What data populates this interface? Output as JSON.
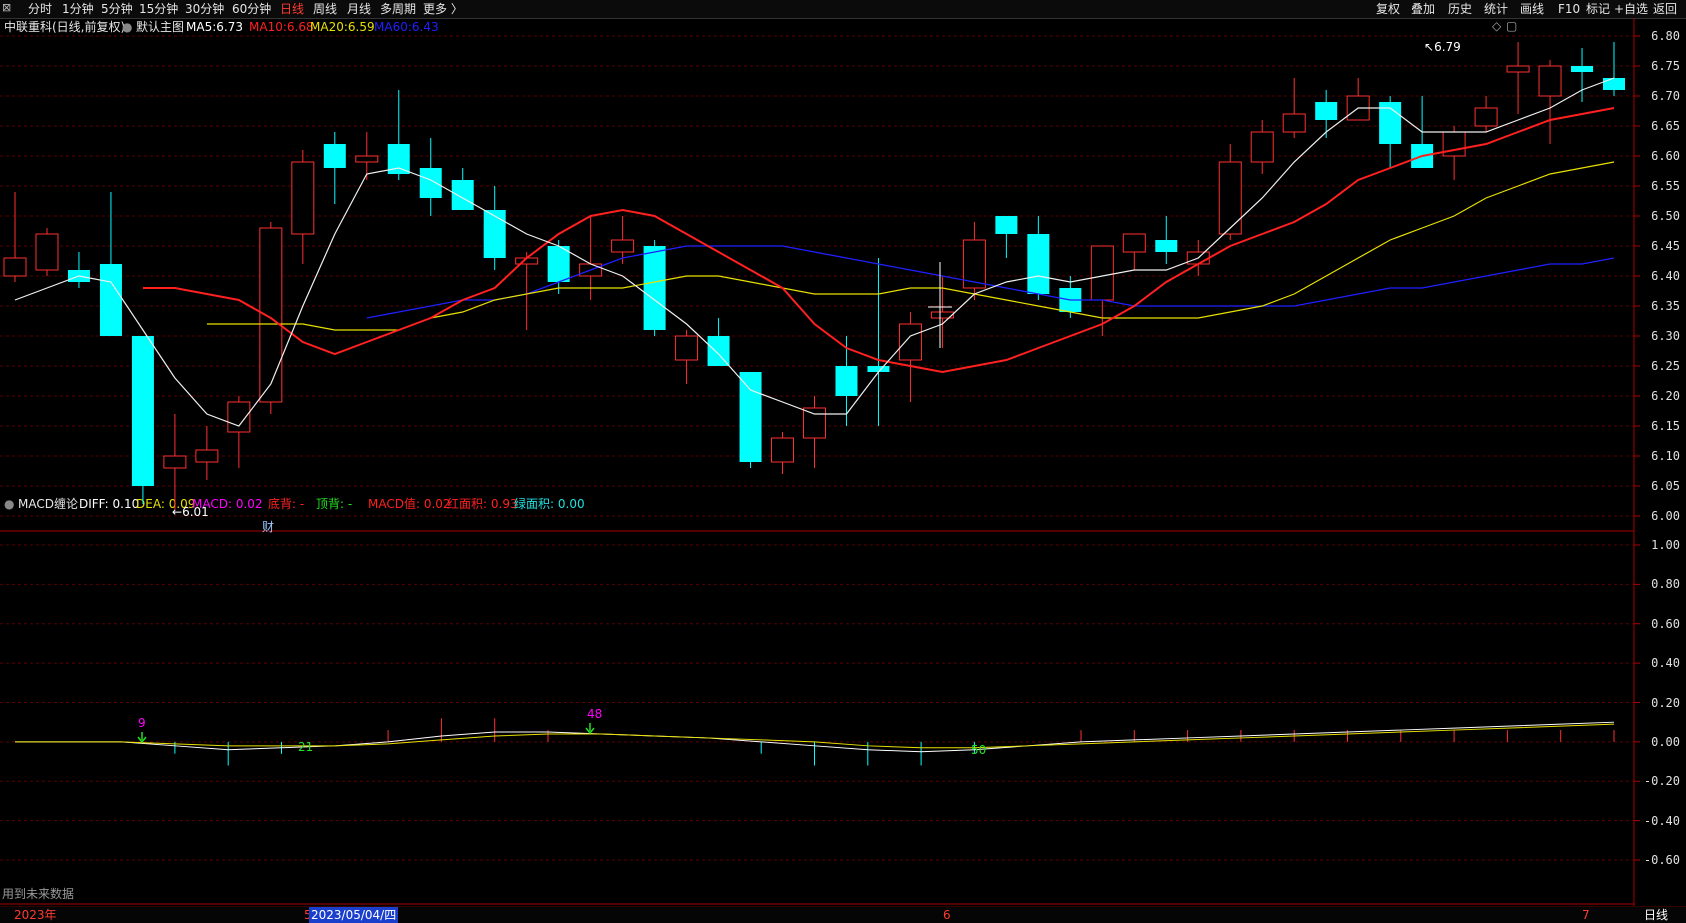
{
  "toolbar": {
    "left": [
      {
        "label": "分时",
        "active": false
      },
      {
        "label": "1分钟",
        "active": false
      },
      {
        "label": "5分钟",
        "active": false
      },
      {
        "label": "15分钟",
        "active": false
      },
      {
        "label": "30分钟",
        "active": false
      },
      {
        "label": "60分钟",
        "active": false
      },
      {
        "label": "日线",
        "active": true
      },
      {
        "label": "周线",
        "active": false
      },
      {
        "label": "月线",
        "active": false
      },
      {
        "label": "多周期",
        "active": false
      },
      {
        "label": "更多 〉",
        "active": false
      }
    ],
    "right": [
      "复权",
      "叠加",
      "历史",
      "统计",
      "画线",
      "F10",
      "标记",
      "+自选",
      "返回"
    ]
  },
  "main_chart": {
    "stock_label": "中联重科(日线,前复权)",
    "template_label": "默认主图",
    "ma5": {
      "label": "MA5:",
      "value": "6.73",
      "color": "#ffffff"
    },
    "ma10": {
      "label": "MA10:",
      "value": "6.68",
      "color": "#ff2020"
    },
    "ma20": {
      "label": "MA20:",
      "value": "6.59",
      "color": "#e8e000"
    },
    "ma60": {
      "label": "MA60:",
      "value": "6.43",
      "color": "#2020ff"
    },
    "max_label": "6.79",
    "min_label": "6.01",
    "fin_marker": "财",
    "y_axis": [
      "6.80",
      "6.75",
      "6.70",
      "6.65",
      "6.60",
      "6.55",
      "6.50",
      "6.45",
      "6.40",
      "6.35",
      "6.30",
      "6.25",
      "6.20",
      "6.15",
      "6.10",
      "6.05",
      "6.00"
    ]
  },
  "macd_panel": {
    "title": "MACD缠论",
    "diff": {
      "label": "DIFF:",
      "value": "0.10",
      "color": "#ffffff"
    },
    "dea": {
      "label": "DEA:",
      "value": "0.09",
      "color": "#e8e000"
    },
    "macd": {
      "label": "MACD:",
      "value": "0.02",
      "color": "#ff00ff"
    },
    "bottom_div": {
      "label": "底背:",
      "value": "-",
      "color": "#ff2020"
    },
    "top_div": {
      "label": "顶背:",
      "value": "-",
      "color": "#20e020"
    },
    "macd_val": {
      "label": "MACD值:",
      "value": "0.02",
      "color": "#ff2020"
    },
    "red_area": {
      "label": "红面积:",
      "value": "0.93",
      "color": "#ff2020"
    },
    "green_area": {
      "label": "绿面积:",
      "value": "0.00",
      "color": "#20e0e0"
    },
    "y_axis": [
      "1.00",
      "0.80",
      "0.60",
      "0.40",
      "0.20",
      "0.00",
      "-0.20",
      "-0.40",
      "-0.60"
    ],
    "markers": [
      {
        "text": "9",
        "color": "#ff00ff"
      },
      {
        "text": "21",
        "color": "#20e020"
      },
      {
        "text": "48",
        "color": "#ff00ff"
      },
      {
        "text": "50",
        "color": "#20e020"
      }
    ]
  },
  "footer": {
    "future_data_note": "用到未来数据",
    "year_label": "2023年",
    "month5_label": "5",
    "selected_date": "2023/05/04/四",
    "month6_label": "6",
    "month7_label": "7",
    "period_button": "日线"
  },
  "chart_data": {
    "type": "candlestick",
    "ylim": [
      6.0,
      6.8
    ],
    "candles": [
      {
        "o": 6.4,
        "h": 6.54,
        "l": 6.39,
        "c": 6.43
      },
      {
        "o": 6.41,
        "h": 6.48,
        "l": 6.4,
        "c": 6.47
      },
      {
        "o": 6.41,
        "h": 6.44,
        "l": 6.38,
        "c": 6.39
      },
      {
        "o": 6.42,
        "h": 6.54,
        "l": 6.33,
        "c": 6.3
      },
      {
        "o": 6.3,
        "h": 6.3,
        "l": 6.02,
        "c": 6.05
      },
      {
        "o": 6.08,
        "h": 6.17,
        "l": 6.01,
        "c": 6.1
      },
      {
        "o": 6.09,
        "h": 6.15,
        "l": 6.06,
        "c": 6.11
      },
      {
        "o": 6.14,
        "h": 6.2,
        "l": 6.08,
        "c": 6.19
      },
      {
        "o": 6.19,
        "h": 6.49,
        "l": 6.17,
        "c": 6.48
      },
      {
        "o": 6.47,
        "h": 6.61,
        "l": 6.42,
        "c": 6.59
      },
      {
        "o": 6.62,
        "h": 6.64,
        "l": 6.52,
        "c": 6.58
      },
      {
        "o": 6.59,
        "h": 6.64,
        "l": 6.56,
        "c": 6.6
      },
      {
        "o": 6.62,
        "h": 6.71,
        "l": 6.56,
        "c": 6.57
      },
      {
        "o": 6.58,
        "h": 6.63,
        "l": 6.5,
        "c": 6.53
      },
      {
        "o": 6.56,
        "h": 6.58,
        "l": 6.51,
        "c": 6.51
      },
      {
        "o": 6.51,
        "h": 6.55,
        "l": 6.41,
        "c": 6.43
      },
      {
        "o": 6.42,
        "h": 6.44,
        "l": 6.31,
        "c": 6.43
      },
      {
        "o": 6.45,
        "h": 6.46,
        "l": 6.37,
        "c": 6.39
      },
      {
        "o": 6.4,
        "h": 6.5,
        "l": 6.36,
        "c": 6.42
      },
      {
        "o": 6.44,
        "h": 6.5,
        "l": 6.42,
        "c": 6.46
      },
      {
        "o": 6.45,
        "h": 6.46,
        "l": 6.3,
        "c": 6.31
      },
      {
        "o": 6.26,
        "h": 6.31,
        "l": 6.22,
        "c": 6.3
      },
      {
        "o": 6.3,
        "h": 6.33,
        "l": 6.25,
        "c": 6.25
      },
      {
        "o": 6.24,
        "h": 6.24,
        "l": 6.08,
        "c": 6.09
      },
      {
        "o": 6.09,
        "h": 6.14,
        "l": 6.07,
        "c": 6.13
      },
      {
        "o": 6.13,
        "h": 6.2,
        "l": 6.08,
        "c": 6.18
      },
      {
        "o": 6.25,
        "h": 6.3,
        "l": 6.15,
        "c": 6.2
      },
      {
        "o": 6.25,
        "h": 6.43,
        "l": 6.15,
        "c": 6.24
      },
      {
        "o": 6.26,
        "h": 6.34,
        "l": 6.19,
        "c": 6.32
      },
      {
        "o": 6.33,
        "h": 6.4,
        "l": 6.28,
        "c": 6.34
      },
      {
        "o": 6.38,
        "h": 6.49,
        "l": 6.36,
        "c": 6.46
      },
      {
        "o": 6.5,
        "h": 6.5,
        "l": 6.43,
        "c": 6.47
      },
      {
        "o": 6.47,
        "h": 6.5,
        "l": 6.36,
        "c": 6.37
      },
      {
        "o": 6.38,
        "h": 6.4,
        "l": 6.33,
        "c": 6.34
      },
      {
        "o": 6.36,
        "h": 6.45,
        "l": 6.3,
        "c": 6.45
      },
      {
        "o": 6.44,
        "h": 6.47,
        "l": 6.41,
        "c": 6.47
      },
      {
        "o": 6.46,
        "h": 6.5,
        "l": 6.42,
        "c": 6.44
      },
      {
        "o": 6.42,
        "h": 6.46,
        "l": 6.4,
        "c": 6.44
      },
      {
        "o": 6.47,
        "h": 6.62,
        "l": 6.46,
        "c": 6.59
      },
      {
        "o": 6.59,
        "h": 6.66,
        "l": 6.57,
        "c": 6.64
      },
      {
        "o": 6.64,
        "h": 6.73,
        "l": 6.63,
        "c": 6.67
      },
      {
        "o": 6.69,
        "h": 6.71,
        "l": 6.63,
        "c": 6.66
      },
      {
        "o": 6.66,
        "h": 6.73,
        "l": 6.66,
        "c": 6.7
      },
      {
        "o": 6.69,
        "h": 6.7,
        "l": 6.58,
        "c": 6.62
      },
      {
        "o": 6.62,
        "h": 6.7,
        "l": 6.58,
        "c": 6.58
      },
      {
        "o": 6.6,
        "h": 6.65,
        "l": 6.56,
        "c": 6.64
      },
      {
        "o": 6.65,
        "h": 6.7,
        "l": 6.64,
        "c": 6.68
      },
      {
        "o": 6.74,
        "h": 6.79,
        "l": 6.67,
        "c": 6.75
      },
      {
        "o": 6.7,
        "h": 6.76,
        "l": 6.62,
        "c": 6.75
      },
      {
        "o": 6.75,
        "h": 6.78,
        "l": 6.69,
        "c": 6.74
      },
      {
        "o": 6.73,
        "h": 6.79,
        "l": 6.7,
        "c": 6.71
      }
    ],
    "ma5": [
      6.36,
      6.38,
      6.4,
      6.39,
      6.31,
      6.23,
      6.17,
      6.15,
      6.22,
      6.35,
      6.47,
      6.57,
      6.58,
      6.56,
      6.53,
      6.5,
      6.47,
      6.45,
      6.42,
      6.4,
      6.36,
      6.32,
      6.27,
      6.21,
      6.19,
      6.17,
      6.17,
      6.24,
      6.3,
      6.32,
      6.37,
      6.39,
      6.4,
      6.39,
      6.4,
      6.41,
      6.41,
      6.43,
      6.48,
      6.53,
      6.59,
      6.64,
      6.68,
      6.68,
      6.64,
      6.64,
      6.64,
      6.66,
      6.68,
      6.71,
      6.73
    ],
    "ma10": [
      6.38,
      6.38,
      6.37,
      6.36,
      6.33,
      6.29,
      6.27,
      6.29,
      6.31,
      6.33,
      6.36,
      6.38,
      6.43,
      6.47,
      6.5,
      6.51,
      6.5,
      6.47,
      6.44,
      6.41,
      6.38,
      6.32,
      6.28,
      6.26,
      6.25,
      6.24,
      6.25,
      6.26,
      6.28,
      6.3,
      6.32,
      6.35,
      6.39,
      6.42,
      6.45,
      6.47,
      6.49,
      6.52,
      6.56,
      6.58,
      6.6,
      6.61,
      6.62,
      6.64,
      6.66,
      6.67,
      6.68
    ],
    "ma20": [
      6.32,
      6.32,
      6.32,
      6.32,
      6.31,
      6.31,
      6.31,
      6.33,
      6.34,
      6.36,
      6.37,
      6.38,
      6.38,
      6.38,
      6.39,
      6.4,
      6.4,
      6.39,
      6.38,
      6.37,
      6.37,
      6.37,
      6.38,
      6.38,
      6.37,
      6.36,
      6.35,
      6.34,
      6.33,
      6.33,
      6.33,
      6.33,
      6.34,
      6.35,
      6.37,
      6.4,
      6.43,
      6.46,
      6.48,
      6.5,
      6.53,
      6.55,
      6.57,
      6.58,
      6.59
    ],
    "ma60": [
      6.33,
      6.34,
      6.35,
      6.36,
      6.36,
      6.37,
      6.39,
      6.41,
      6.43,
      6.44,
      6.45,
      6.45,
      6.45,
      6.45,
      6.44,
      6.43,
      6.42,
      6.41,
      6.4,
      6.39,
      6.38,
      6.37,
      6.36,
      6.36,
      6.35,
      6.35,
      6.35,
      6.35,
      6.35,
      6.35,
      6.36,
      6.37,
      6.38,
      6.38,
      6.39,
      6.4,
      6.41,
      6.42,
      6.42,
      6.43
    ],
    "macd_ylim": [
      -0.6,
      1.0
    ],
    "diff": [
      0.0,
      0.0,
      0.0,
      -0.02,
      -0.04,
      -0.03,
      -0.02,
      0.0,
      0.03,
      0.05,
      0.05,
      0.04,
      0.03,
      0.02,
      0.0,
      -0.02,
      -0.04,
      -0.05,
      -0.04,
      -0.02,
      0.0,
      0.01,
      0.02,
      0.03,
      0.04,
      0.05,
      0.06,
      0.07,
      0.08,
      0.09,
      0.1
    ],
    "dea": [
      0.0,
      0.0,
      0.0,
      -0.01,
      -0.02,
      -0.02,
      -0.02,
      -0.01,
      0.01,
      0.03,
      0.04,
      0.04,
      0.03,
      0.02,
      0.01,
      0.0,
      -0.02,
      -0.03,
      -0.03,
      -0.02,
      -0.01,
      0.0,
      0.01,
      0.02,
      0.03,
      0.04,
      0.05,
      0.06,
      0.07,
      0.08,
      0.09
    ]
  }
}
